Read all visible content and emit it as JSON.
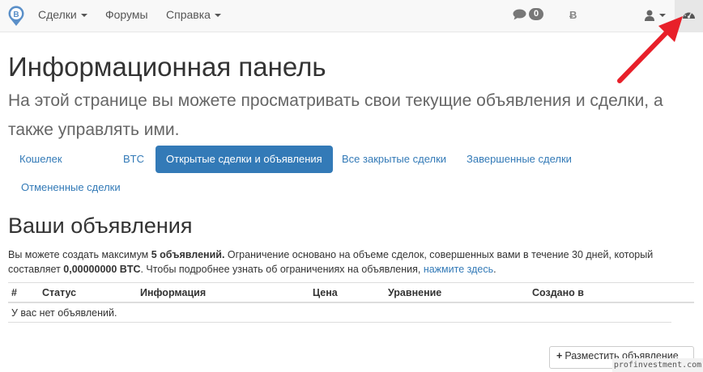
{
  "navbar": {
    "menu": [
      {
        "label": "Сделки",
        "has_caret": true
      },
      {
        "label": "Форумы",
        "has_caret": false
      },
      {
        "label": "Справка",
        "has_caret": true
      }
    ],
    "messages_count": "0",
    "btc_symbol": "Ƀ"
  },
  "header": {
    "title": "Информационная панель",
    "lead": "На этой странице вы можете просматривать свои текущие объявления и сделки, а также управлять ими."
  },
  "tabs": [
    {
      "label": "Кошелек",
      "active": false
    },
    {
      "label": "BTC",
      "active": false
    },
    {
      "label": "Открытые сделки и объявления",
      "active": true
    },
    {
      "label": "Все закрытые сделки",
      "active": false
    },
    {
      "label": "Завершенные сделки",
      "active": false
    },
    {
      "label": "Отмененные сделки",
      "active": false
    }
  ],
  "ads": {
    "title": "Ваши объявления",
    "info_prefix": "Вы можете создать максимум ",
    "info_max": "5 объявлений.",
    "info_middle": " Ограничение основано на объеме сделок, совершенных вами в течение 30 дней, который составляет ",
    "info_amount": "0,00000000 BTC",
    "info_suffix": ". Чтобы подробнее узнать об ограничениях на объявления, ",
    "info_link": "нажмите здесь",
    "info_end": ".",
    "columns": [
      "#",
      "Статус",
      "Информация",
      "Цена",
      "Уравнение",
      "Создано в"
    ],
    "empty_text": "У вас нет объявлений.",
    "place_button": "Разместить объявление"
  },
  "watermark": "profinvestment.com",
  "colors": {
    "accent": "#337ab7",
    "arrow": "#e8202a"
  }
}
